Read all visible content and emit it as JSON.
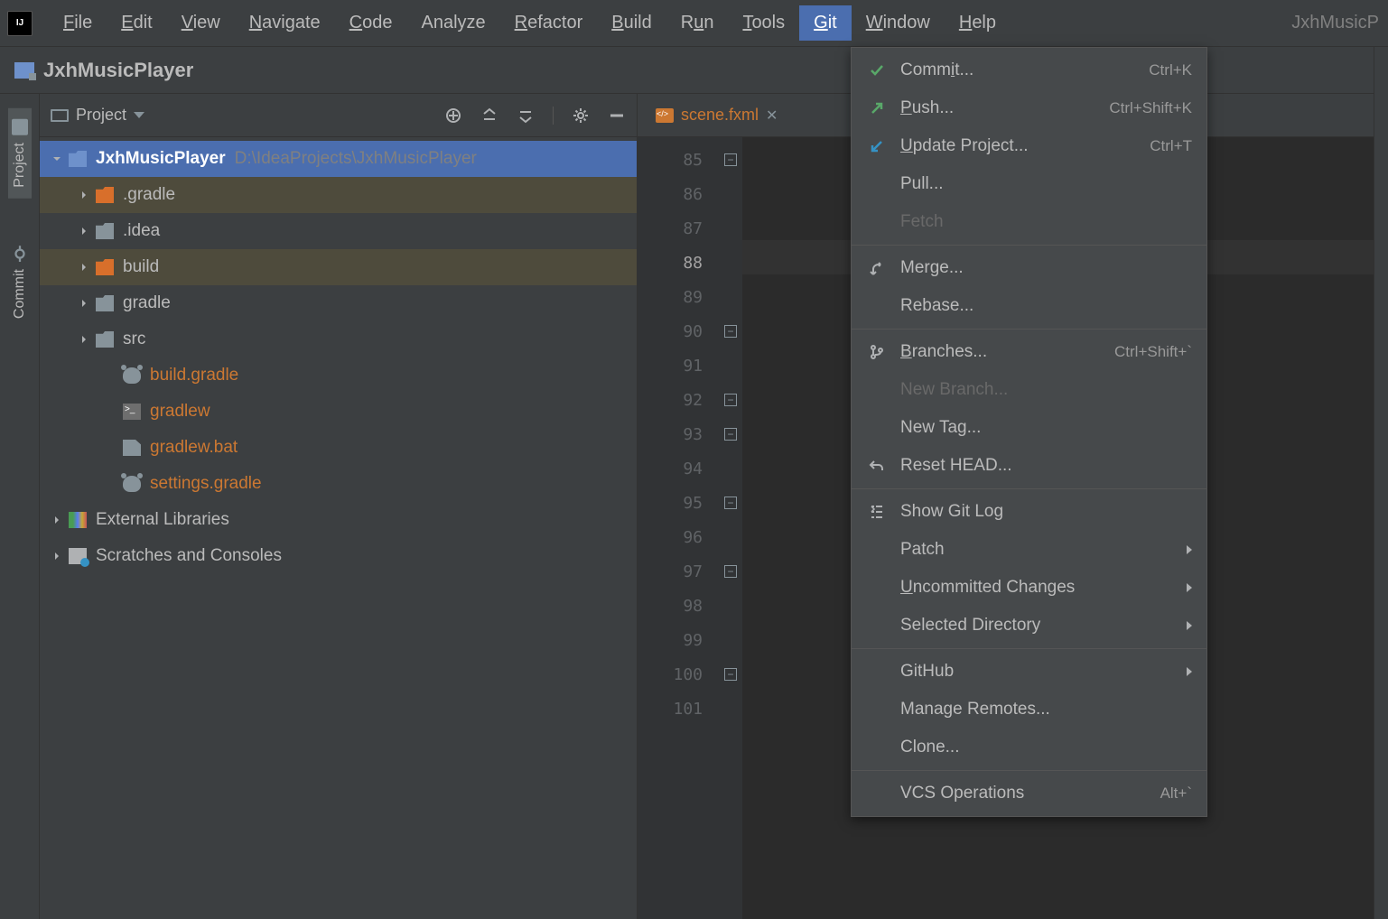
{
  "menubar": {
    "items": [
      {
        "label": "File",
        "mn": "F"
      },
      {
        "label": "Edit",
        "mn": "E"
      },
      {
        "label": "View",
        "mn": "V"
      },
      {
        "label": "Navigate",
        "mn": "N"
      },
      {
        "label": "Code",
        "mn": "C"
      },
      {
        "label": "Analyze",
        "mn": ""
      },
      {
        "label": "Refactor",
        "mn": "R"
      },
      {
        "label": "Build",
        "mn": "B"
      },
      {
        "label": "Run",
        "mn": "u"
      },
      {
        "label": "Tools",
        "mn": "T"
      },
      {
        "label": "Git",
        "mn": "G",
        "active": true
      },
      {
        "label": "Window",
        "mn": "W"
      },
      {
        "label": "Help",
        "mn": "H"
      }
    ],
    "title_right": "JxhMusicP"
  },
  "navbar": {
    "project_name": "JxhMusicPlayer"
  },
  "toolstrip": {
    "tabs": [
      {
        "label": "Project",
        "active": true
      },
      {
        "label": "Commit",
        "active": false
      }
    ]
  },
  "project_panel": {
    "header_label": "Project",
    "tree": {
      "root": {
        "name": "JxhMusicPlayer",
        "path": "D:\\IdeaProjects\\JxhMusicPlayer"
      },
      "items": [
        {
          "indent": 1,
          "arrow": "right",
          "icon": "folder-orange",
          "label": ".gradle",
          "highlighted": true
        },
        {
          "indent": 1,
          "arrow": "right",
          "icon": "folder-grey",
          "label": ".idea"
        },
        {
          "indent": 1,
          "arrow": "right",
          "icon": "folder-orange",
          "label": "build",
          "highlighted": true
        },
        {
          "indent": 1,
          "arrow": "right",
          "icon": "folder-grey",
          "label": "gradle"
        },
        {
          "indent": 1,
          "arrow": "right",
          "icon": "folder-grey",
          "label": "src"
        },
        {
          "indent": 1,
          "arrow": "",
          "icon": "gradle-icon",
          "label": "build.gradle",
          "vcs": true
        },
        {
          "indent": 1,
          "arrow": "",
          "icon": "file-term",
          "label": "gradlew",
          "vcs": true
        },
        {
          "indent": 1,
          "arrow": "",
          "icon": "file-grey",
          "label": "gradlew.bat",
          "vcs": true
        },
        {
          "indent": 1,
          "arrow": "",
          "icon": "gradle-icon",
          "label": "settings.gradle",
          "vcs": true
        }
      ],
      "ext_lib": "External Libraries",
      "scratches": "Scratches and Consoles"
    }
  },
  "editor": {
    "tab": {
      "label": "scene.fxml"
    },
    "lines": [
      85,
      86,
      87,
      88,
      89,
      90,
      91,
      92,
      93,
      94,
      95,
      96,
      97,
      98,
      99,
      100,
      101
    ],
    "current_line": 88,
    "folds": [
      85,
      90,
      92,
      93,
      95,
      97,
      100
    ]
  },
  "git_menu": {
    "groups": [
      [
        {
          "label": "Commit...",
          "mn": "i",
          "shortcut": "Ctrl+K",
          "icon": "check",
          "color": "#59A869"
        },
        {
          "label": "Push...",
          "mn": "P",
          "shortcut": "Ctrl+Shift+K",
          "icon": "arrow-up-right",
          "color": "#59A869"
        },
        {
          "label": "Update Project...",
          "mn": "U",
          "shortcut": "Ctrl+T",
          "icon": "arrow-down-left",
          "color": "#3592C4"
        },
        {
          "label": "Pull...",
          "icon": ""
        },
        {
          "label": "Fetch",
          "icon": "",
          "disabled": true
        }
      ],
      [
        {
          "label": "Merge...",
          "icon": "merge"
        },
        {
          "label": "Rebase...",
          "icon": ""
        }
      ],
      [
        {
          "label": "Branches...",
          "mn": "B",
          "shortcut": "Ctrl+Shift+`",
          "icon": "branch"
        },
        {
          "label": "New Branch...",
          "icon": "",
          "disabled": true
        },
        {
          "label": "New Tag...",
          "icon": ""
        },
        {
          "label": "Reset HEAD...",
          "icon": "undo"
        }
      ],
      [
        {
          "label": "Show Git Log",
          "icon": "loglist"
        },
        {
          "label": "Patch",
          "icon": "",
          "submenu": true
        },
        {
          "label": "Uncommitted Changes",
          "mn": "U",
          "icon": "",
          "submenu": true
        },
        {
          "label": "Selected Directory",
          "icon": "",
          "submenu": true
        }
      ],
      [
        {
          "label": "GitHub",
          "icon": "",
          "submenu": true
        },
        {
          "label": "Manage Remotes...",
          "icon": ""
        },
        {
          "label": "Clone...",
          "icon": ""
        }
      ],
      [
        {
          "label": "VCS Operations",
          "shortcut": "Alt+`",
          "icon": ""
        }
      ]
    ]
  }
}
